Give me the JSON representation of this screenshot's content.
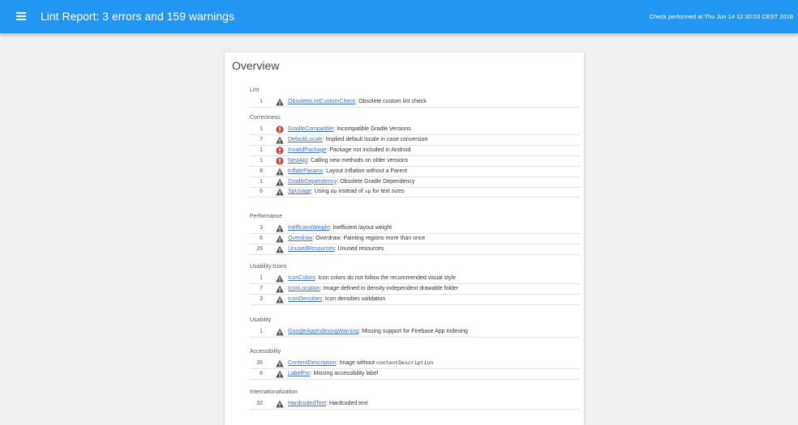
{
  "header": {
    "menu_icon": "menu-icon",
    "title": "Lint Report: 3 errors and 159 warnings",
    "check_text": "Check performed at Thu Jun 14 12:30:03 CEST 2018"
  },
  "colors": {
    "header_bg": "#2196f3",
    "link": "#3f6fd6",
    "error_icon": "#c0504d",
    "warning_icon": "#555555"
  },
  "overview": {
    "title": "Overview",
    "sections": [
      {
        "title": "Lint",
        "rows": [
          {
            "count": "1",
            "icon": "warning-icon",
            "id": "ObsoleteLintCustomCheck",
            "sep": ": ",
            "desc": "Obsolete custom lint check"
          }
        ]
      },
      {
        "title": "Correctness",
        "rows": [
          {
            "count": "1",
            "icon": "error-icon",
            "id": "GradleCompatible",
            "sep": ": ",
            "desc": "Incompatible Gradle Versions"
          },
          {
            "count": "7",
            "icon": "warning-icon",
            "id": "DefaultLocale",
            "sep": ": ",
            "desc": "Implied default locale in case conversion"
          },
          {
            "count": "1",
            "icon": "error-icon",
            "id": "InvalidPackage",
            "sep": ": ",
            "desc": "Package not included in Android"
          },
          {
            "count": "1",
            "icon": "error-icon",
            "id": "NewApi",
            "sep": ": ",
            "desc": "Calling new methods on older versions"
          },
          {
            "count": "8",
            "icon": "warning-icon",
            "id": "InflateParams",
            "sep": ": ",
            "desc": "Layout Inflation without a Parent"
          },
          {
            "count": "1",
            "icon": "warning-icon",
            "id": "GradleDependency",
            "sep": ": ",
            "desc": "Obsolete Gradle Dependency"
          },
          {
            "count": "6",
            "icon": "warning-icon",
            "id": "SpUsage",
            "sep": ": ",
            "desc": "Using ",
            "code1": "dp",
            "mid": " instead of ",
            "code2": "sp",
            "tail": " for text sizes"
          }
        ]
      },
      {
        "title": "Performance",
        "rows": [
          {
            "count": "3",
            "icon": "warning-icon",
            "id": "InefficientWeight",
            "sep": ": ",
            "desc": "Inefficient layout weight"
          },
          {
            "count": "6",
            "icon": "warning-icon",
            "id": "Overdraw",
            "sep": ": ",
            "desc": "Overdraw: Painting regions more than once"
          },
          {
            "count": "26",
            "icon": "warning-icon",
            "id": "UnusedResources",
            "sep": ": ",
            "desc": "Unused resources"
          }
        ]
      },
      {
        "title": "Usability:Icons",
        "rows": [
          {
            "count": "1",
            "icon": "warning-icon",
            "id": "IconColors",
            "sep": ": ",
            "desc": "Icon colors do not follow the recommended visual style"
          },
          {
            "count": "7",
            "icon": "warning-icon",
            "id": "IconLocation",
            "sep": ": ",
            "desc": "Image defined in density-independent drawable folder"
          },
          {
            "count": "3",
            "icon": "warning-icon",
            "id": "IconDensities",
            "sep": ": ",
            "desc": "Icon densities validation"
          }
        ]
      },
      {
        "title": "Usability",
        "rows": [
          {
            "count": "1",
            "icon": "warning-icon",
            "id": "GoogleAppIndexingWarning",
            "sep": ": ",
            "desc": "Missing support for Firebase App Indexing"
          }
        ]
      },
      {
        "title": "Accessibility",
        "rows": [
          {
            "count": "35",
            "icon": "warning-icon",
            "id": "ContentDescription",
            "sep": ": ",
            "desc": "Image without ",
            "code1": "contentDescription"
          },
          {
            "count": "6",
            "icon": "warning-icon",
            "id": "LabelFor",
            "sep": ": ",
            "desc": "Missing accessibility label"
          }
        ]
      },
      {
        "title": "Internationalization",
        "rows": [
          {
            "count": "32",
            "icon": "warning-icon",
            "id": "HardcodedText",
            "sep": ": ",
            "desc": "Hardcoded text"
          }
        ]
      }
    ]
  }
}
